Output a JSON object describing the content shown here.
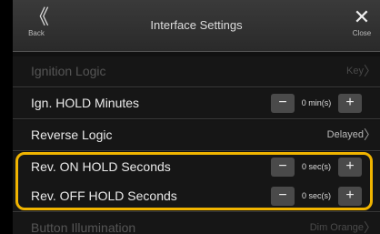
{
  "header": {
    "back_label": "Back",
    "back_glyph": "《",
    "title": "Interface Settings",
    "close_label": "Close",
    "close_glyph": "✕"
  },
  "rows": [
    {
      "label": "Ignition Logic",
      "value": "Key",
      "chev": "〉"
    },
    {
      "label": "Ign. HOLD Minutes",
      "minus": "−",
      "value": "0 min(s)",
      "plus": "+"
    },
    {
      "label": "Reverse Logic",
      "value": "Delayed",
      "chev": "〉"
    },
    {
      "label": "Rev. ON HOLD Seconds",
      "minus": "−",
      "value": "0 sec(s)",
      "plus": "+"
    },
    {
      "label": "Rev. OFF HOLD Seconds",
      "minus": "−",
      "value": "0 sec(s)",
      "plus": "+"
    },
    {
      "label": "Button Illumination",
      "value": "Dim Orange",
      "chev": "〉"
    }
  ],
  "colors": {
    "highlight": "#f0b400"
  }
}
